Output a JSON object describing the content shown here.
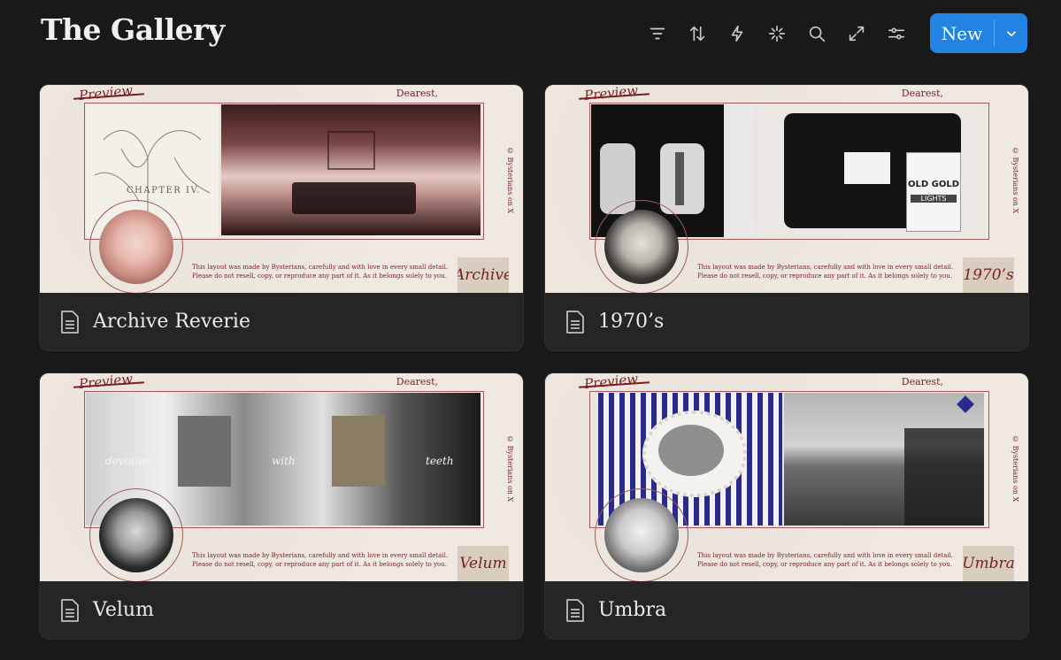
{
  "page": {
    "title": "The Gallery"
  },
  "toolbar": {
    "tools": [
      "filter-icon",
      "sort-icon",
      "lightning-icon",
      "sparkle-icon",
      "search-icon",
      "expand-icon",
      "settings-sliders-icon"
    ],
    "new_label": "New"
  },
  "cards": [
    {
      "name": "Archive Reverie",
      "cover": {
        "chapter": "CHAPTER IV.",
        "signature": "Archive",
        "theme_color": "#e7c9c9"
      }
    },
    {
      "name": "1970’s",
      "cover": {
        "brand_text": "OLD GOLD",
        "brand_sub": "LIGHTS",
        "signature": "1970’s",
        "theme_color": "#cfcfcf"
      }
    },
    {
      "name": "Velum",
      "cover": {
        "words": [
          "devotion",
          "with",
          "teeth"
        ],
        "signature": "Velum",
        "theme_color": "#bfbfbf"
      }
    },
    {
      "name": "Umbra",
      "cover": {
        "signature": "Umbra",
        "theme_color": "#2a2a8a"
      }
    }
  ],
  "cover_common": {
    "preview": "Preview",
    "dearest": "Dearest,",
    "side": "© Bysterians  on  X",
    "note_line1": "This layout was made by Bysterians, carefully and with love in every small detail.",
    "note_line2": "Please do not resell, copy, or reproduce any part of it. As it belongs solely to you."
  },
  "colors": {
    "accent": "#2383e2",
    "background": "#191919",
    "card": "#252525",
    "ink": "#7a1e24"
  }
}
